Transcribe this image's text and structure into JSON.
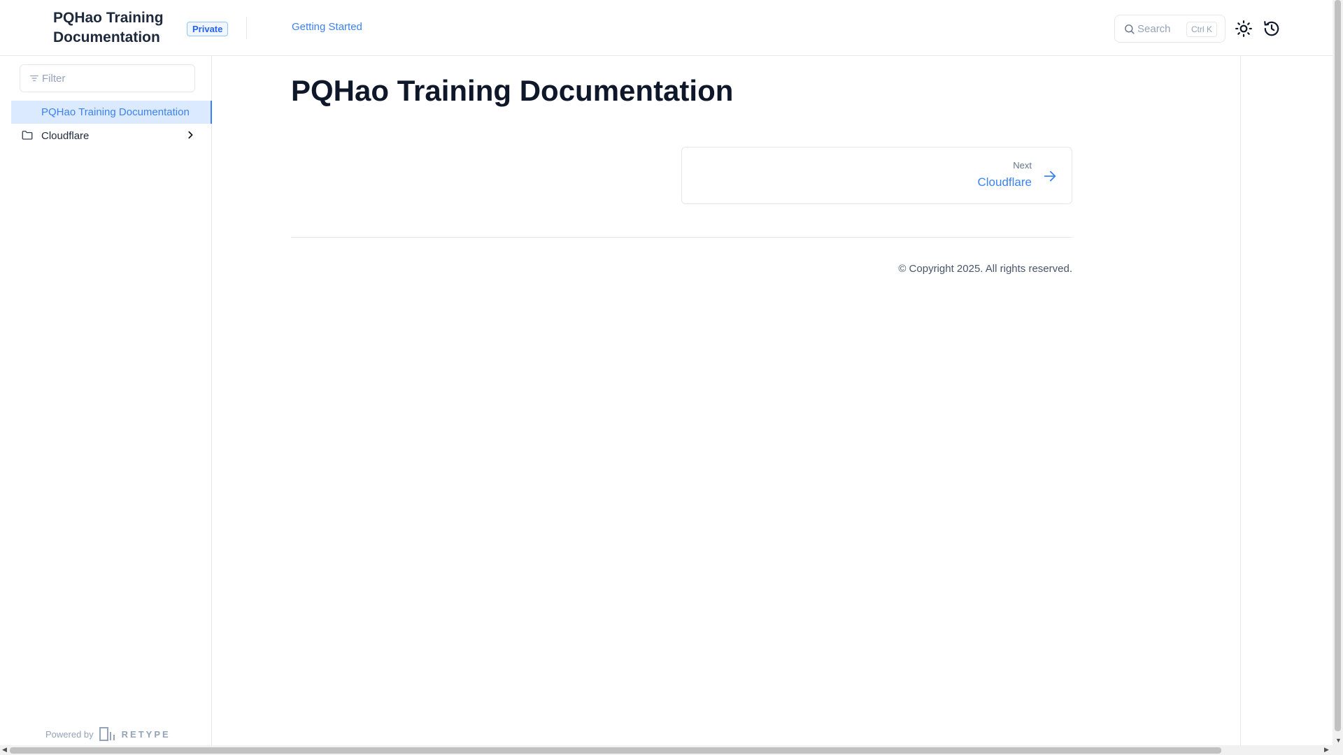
{
  "header": {
    "title": "PQHao Training Documentation",
    "badge": "Private",
    "nav_link": "Getting Started",
    "search": {
      "placeholder": "Search",
      "shortcut": "Ctrl K"
    },
    "theme_toggle_icon": "sun-icon",
    "history_icon": "history-icon"
  },
  "sidebar": {
    "filter_placeholder": "Filter",
    "items": [
      {
        "label": "PQHao Training Documentation",
        "active": true
      },
      {
        "label": "Cloudflare",
        "icon": "folder-icon",
        "expandable": true
      }
    ],
    "powered_by": "Powered by",
    "brand": "RETYPE"
  },
  "main": {
    "title": "PQHao Training Documentation",
    "next": {
      "label": "Next",
      "title": "Cloudflare"
    },
    "copyright": "© Copyright 2025. All rights reserved."
  },
  "colors": {
    "accent": "#3b82f6",
    "active_bg": "#dbeafe",
    "border": "#e5e7eb",
    "text": "#1e293b"
  }
}
